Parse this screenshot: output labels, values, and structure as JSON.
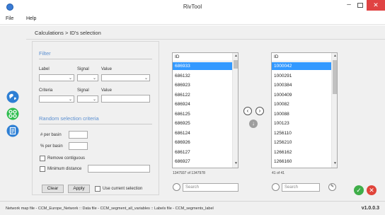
{
  "window": {
    "title": "RivTool"
  },
  "menu": {
    "items": [
      "File",
      "Help"
    ]
  },
  "breadcrumb": "Calculations > ID's selection",
  "filter": {
    "title": "Filter",
    "label_col": "Label",
    "signal_col": "Signal",
    "value_col": "Value",
    "criteria_col": "Criteria",
    "signal_col2": "Signal",
    "value_col2": "Value"
  },
  "random": {
    "title": "Random selection criteria",
    "per_basin": "# per basin",
    "pct_per_basin": "% per basin",
    "remove_contiguous": "Remove contiguous",
    "minimum_distance": "Minimum distance"
  },
  "actions": {
    "clear": "Clear",
    "apply": "Apply",
    "use_current_selection": "Use current selection"
  },
  "left_list": {
    "header": "ID",
    "rows": [
      "686933",
      "686132",
      "686923",
      "686122",
      "686924",
      "686125",
      "686925",
      "686124",
      "686926",
      "686127",
      "686927"
    ],
    "selected_index": 0,
    "count": "1347937 of 1347978",
    "search_placeholder": "Search"
  },
  "right_list": {
    "header": "ID",
    "rows": [
      "1000042",
      "1000291",
      "1000384",
      "1000409",
      "100082",
      "100088",
      "100123",
      "1256110",
      "1256210",
      "1266162",
      "1266160"
    ],
    "selected_index": 0,
    "count": "41 of 41",
    "search_placeholder": "Search"
  },
  "status": {
    "text": "Network map file - CCM_Europe_Network :: Data file - CCM_segment_all_variables :: Labels file - CCM_segments_label",
    "version": "v1.0.0.3"
  },
  "icons": {
    "app": "app-icon",
    "rail": [
      "globe-icon",
      "network-icon",
      "document-icon"
    ],
    "move_left": "chevron-left-icon",
    "move_right": "chevron-right-icon",
    "move_down": "arrow-down-icon",
    "ok": "checkmark-icon",
    "cancel": "close-icon"
  },
  "colors": {
    "accent": "#5b8fd1",
    "selection": "#3399ff",
    "ok": "#3fae49",
    "cancel": "#e0443a",
    "rail_globe": "#2e7fd4",
    "rail_network": "#2ebd4e",
    "rail_doc": "#2e7fd4"
  }
}
